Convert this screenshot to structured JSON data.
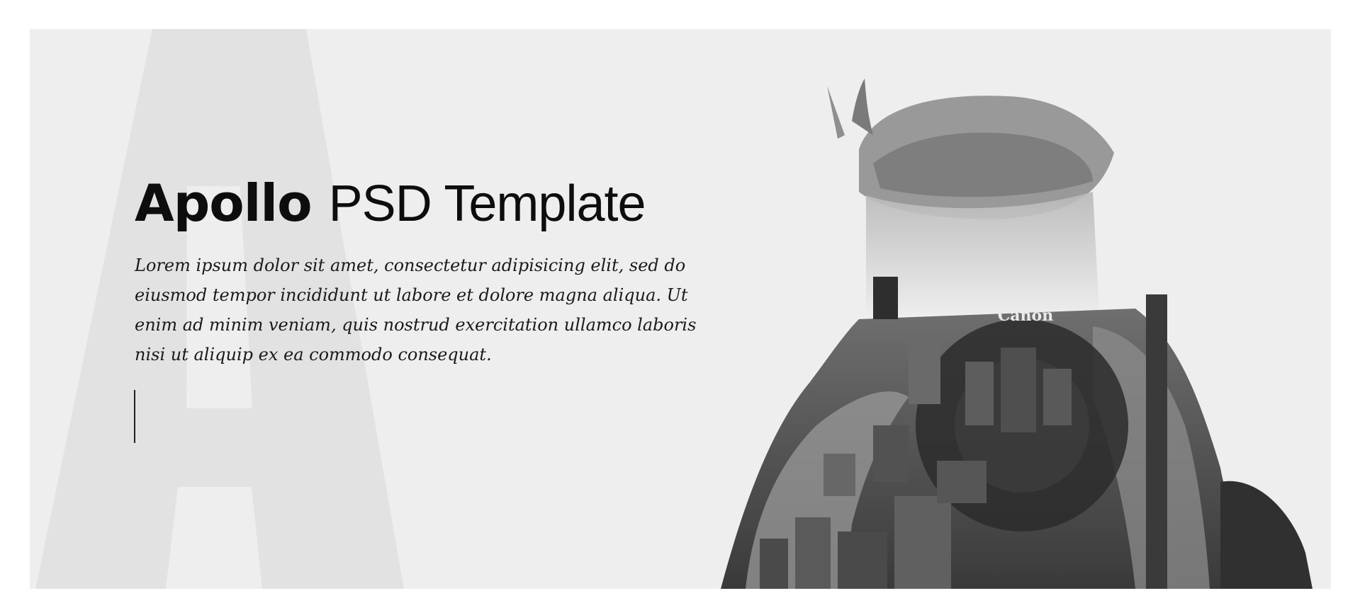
{
  "hero": {
    "title_bold": "Apollo",
    "title_rest": "PSD Template",
    "description": "Lorem ipsum dolor sit amet, consectetur adipisicing elit, sed do eiusmod tempor incididunt ut labore et dolore magna aliqua. Ut enim ad minim veniam, quis nostrud exercitation ullamco laboris nisi ut aliquip ex ea commodo consequat.",
    "watermark_letter": "A",
    "camera_brand": "Canon"
  },
  "colors": {
    "page_bg": "#ffffff",
    "hero_bg": "#eeeeee",
    "watermark": "#e2e2e2",
    "text": "#0d0d0d"
  }
}
